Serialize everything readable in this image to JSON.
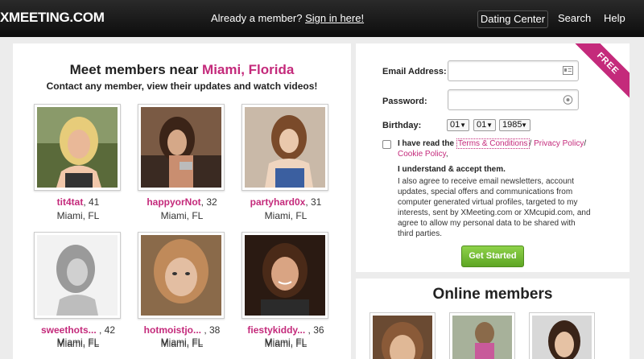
{
  "header": {
    "logo": "XMEETING.COM",
    "already_text": "Already a member?",
    "sign_in": "Sign in here!",
    "nav": [
      "Dating Center",
      "Search",
      "Help"
    ]
  },
  "left": {
    "title_prefix": "Meet members near ",
    "location": "Miami, Florida",
    "subtitle": "Contact any member, view their updates and watch videos!",
    "members": [
      {
        "name": "tit4tat",
        "age": ", 41",
        "loc": "Miami, FL"
      },
      {
        "name": "happyorNot",
        "age": ", 32",
        "loc": "Miami, FL"
      },
      {
        "name": "partyhard0x",
        "age": ", 31",
        "loc": "Miami, FL"
      },
      {
        "name": "sweethots...",
        "age": " , 42",
        "loc": "Miami, FL"
      },
      {
        "name": "hotmoistjo...",
        "age": " , 38",
        "loc": "Miami, FL"
      },
      {
        "name": "fiestykiddy...",
        "age": " , 36",
        "loc": "Miami, FL"
      },
      {
        "name": "",
        "age": "",
        "loc": "Miami, FL"
      },
      {
        "name": "",
        "age": "",
        "loc": "Miami, FL"
      },
      {
        "name": "",
        "age": "",
        "loc": "Miami, FL"
      }
    ]
  },
  "signup": {
    "badge": "FREE",
    "email_label": "Email Address:",
    "email_value": "",
    "password_label": "Password:",
    "password_value": "",
    "birthday_label": "Birthday:",
    "birthday": {
      "month": "01",
      "day": "01",
      "year": "1985"
    },
    "read_text": "I have read the",
    "terms": "Terms & Conditions",
    "privacy": "Privacy Policy",
    "cookie": "Cookie Policy",
    "slash": "/",
    "comma": ",",
    "accept": "I understand & accept them.",
    "consent": "I also agree to receive email newsletters, account updates, special offers and communications from computer generated virtual profiles, targeted to my interests, sent by XMeeting.com or XMcupid.com, and agree to allow my personal data to be shared with third parties.",
    "button": "Get Started"
  },
  "online": {
    "title": "Online members"
  },
  "icons": {
    "email": "contact-card-icon",
    "password": "eye-icon"
  },
  "colors": {
    "accent": "#c42a7b",
    "button": "#6db22f",
    "header": "#111111"
  }
}
